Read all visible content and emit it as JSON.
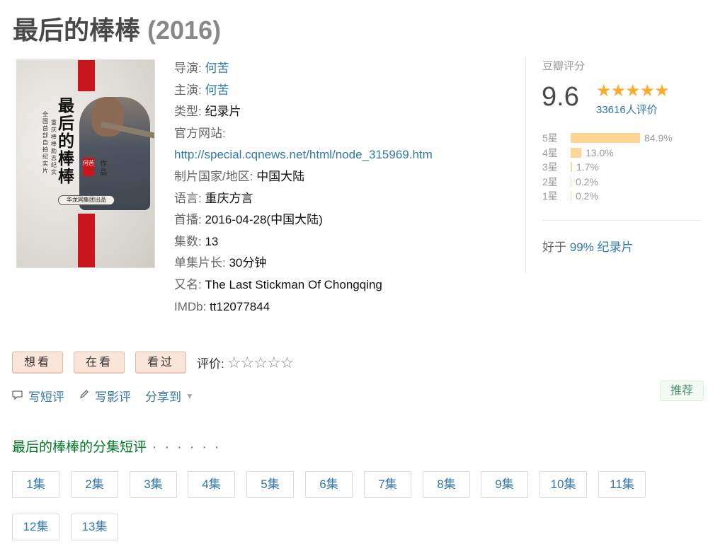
{
  "title": "最后的棒棒",
  "year": "(2016)",
  "poster": {
    "title_chars": [
      "最",
      "后",
      "的",
      "棒",
      "棒"
    ],
    "subtitle_a": "全国首部自拍纪实片",
    "subtitle_b": "重庆棒棒励志纪实",
    "seal": "何苦",
    "works": "作品",
    "producer": "华龙网集团出品"
  },
  "info": {
    "director_label": "导演:",
    "director": "何苦",
    "cast_label": "主演:",
    "cast": "何苦",
    "genre_label": "类型:",
    "genre": "纪录片",
    "website_label": "官方网站:",
    "website": "http://special.cqnews.net/html/node_315969.htm",
    "region_label": "制片国家/地区:",
    "region": "中国大陆",
    "language_label": "语言:",
    "language": "重庆方言",
    "premiere_label": "首播:",
    "premiere": "2016-04-28(中国大陆)",
    "episodes_label": "集数:",
    "episodes": "13",
    "runtime_label": "单集片长:",
    "runtime": "30分钟",
    "aka_label": "又名:",
    "aka": "The Last Stickman Of Chongqing",
    "imdb_label": "IMDb:",
    "imdb": "tt12077844"
  },
  "rating": {
    "label": "豆瓣评分",
    "score": "9.6",
    "stars": "★★★★★",
    "votes": "33616人评价",
    "distribution": [
      {
        "label": "5星",
        "percent": 84.9,
        "text": "84.9%"
      },
      {
        "label": "4星",
        "percent": 13.0,
        "text": "13.0%"
      },
      {
        "label": "3星",
        "percent": 1.7,
        "text": "1.7%"
      },
      {
        "label": "2星",
        "percent": 0.2,
        "text": "0.2%"
      },
      {
        "label": "1星",
        "percent": 0.2,
        "text": "0.2%"
      }
    ],
    "better_prefix": "好于",
    "better_link": "99% 纪录片"
  },
  "actions": {
    "want": "想看",
    "watching": "在看",
    "watched": "看过",
    "rate_label": "评价:",
    "rate_stars": "☆☆☆☆☆"
  },
  "sub_actions": {
    "short_review": "写短评",
    "review": "写影评",
    "share": "分享到"
  },
  "recommend": "推荐",
  "section": {
    "title": "最后的棒棒的分集短评",
    "dots": "· · · · · ·"
  },
  "episode_list": [
    "1集",
    "2集",
    "3集",
    "4集",
    "5集",
    "6集",
    "7集",
    "8集",
    "9集",
    "10集",
    "11集",
    "12集",
    "13集"
  ]
}
